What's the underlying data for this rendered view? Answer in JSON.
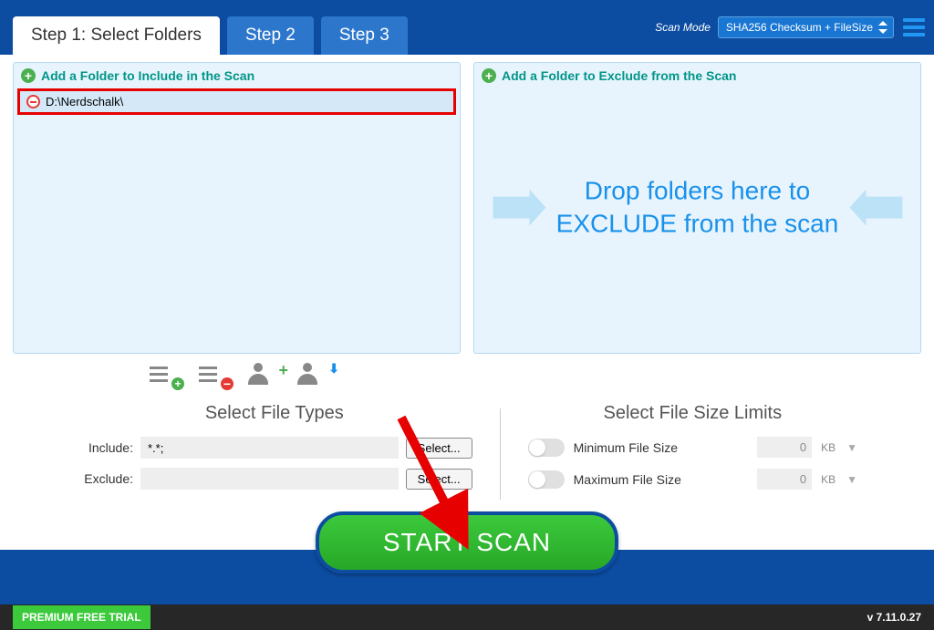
{
  "header": {
    "tabs": [
      {
        "label": "Step 1: Select Folders",
        "active": true
      },
      {
        "label": "Step 2",
        "active": false
      },
      {
        "label": "Step 3",
        "active": false
      }
    ],
    "scan_mode_label": "Scan Mode",
    "scan_mode_value": "SHA256 Checksum + FileSize"
  },
  "include_panel": {
    "header": "Add a Folder to Include in the Scan",
    "folders": [
      "D:\\Nerdschalk\\"
    ]
  },
  "exclude_panel": {
    "header": "Add a Folder to Exclude from the Scan",
    "drop_text": "Drop folders here to EXCLUDE from the scan"
  },
  "file_types": {
    "title": "Select File Types",
    "include_label": "Include:",
    "include_value": "*.*;",
    "exclude_label": "Exclude:",
    "exclude_value": "",
    "select_btn": "Select..."
  },
  "file_size": {
    "title": "Select File Size Limits",
    "min_label": "Minimum File Size",
    "max_label": "Maximum File Size",
    "min_value": "0",
    "max_value": "0",
    "unit": "KB"
  },
  "start_scan": "START SCAN",
  "footer": {
    "trial": "PREMIUM FREE TRIAL",
    "version": "v 7.11.0.27"
  }
}
